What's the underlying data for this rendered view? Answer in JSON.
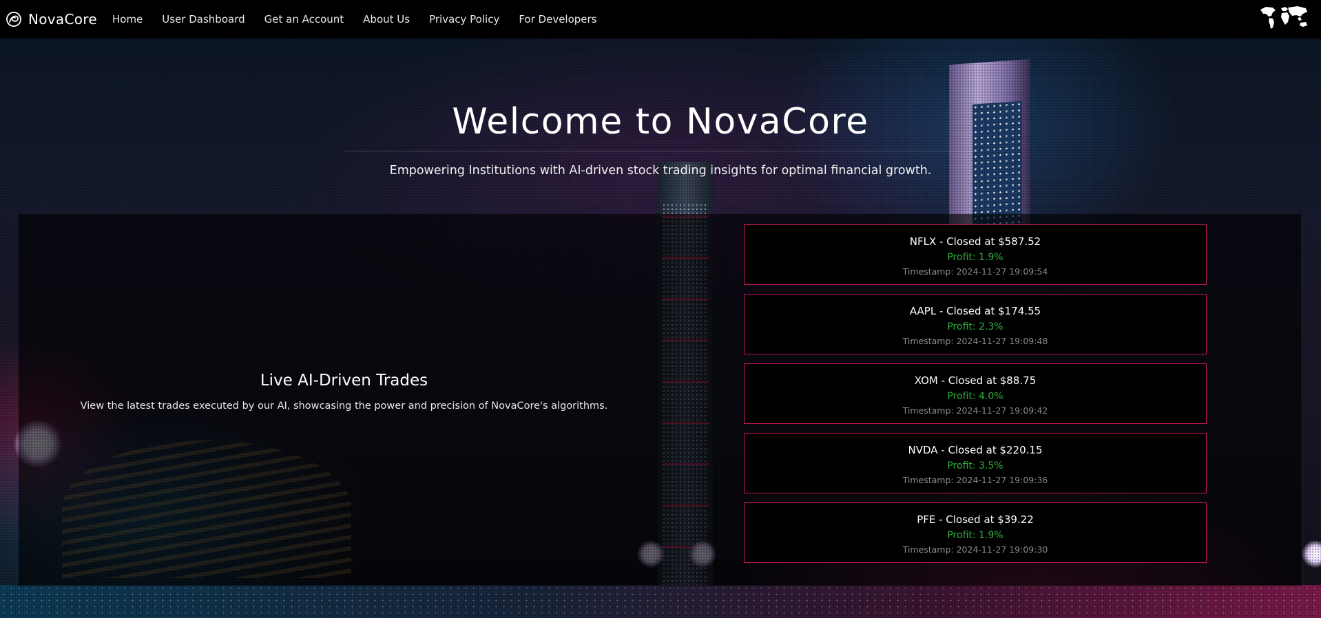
{
  "navbar": {
    "brand": "NovaCore",
    "links": [
      {
        "label": "Home"
      },
      {
        "label": "User Dashboard"
      },
      {
        "label": "Get an Account"
      },
      {
        "label": "About Us"
      },
      {
        "label": "Privacy Policy"
      },
      {
        "label": "For Developers"
      }
    ],
    "brand_icon": "swirl-logo-icon",
    "language_icon": "world-map-icon"
  },
  "hero": {
    "title": "Welcome to NovaCore",
    "subtitle": "Empowering Institutions with AI-driven stock trading insights for optimal financial growth."
  },
  "trades_section": {
    "title": "Live AI-Driven Trades",
    "description": "View the latest trades executed by our AI, showcasing the power and precision of NovaCore's algorithms.",
    "trades": [
      {
        "title": "NFLX - Closed at $587.52",
        "profit": "Profit: 1.9%",
        "timestamp": "Timestamp: 2024-11-27 19:09:54"
      },
      {
        "title": "AAPL - Closed at $174.55",
        "profit": "Profit: 2.3%",
        "timestamp": "Timestamp: 2024-11-27 19:09:48"
      },
      {
        "title": "XOM - Closed at $88.75",
        "profit": "Profit: 4.0%",
        "timestamp": "Timestamp: 2024-11-27 19:09:42"
      },
      {
        "title": "NVDA - Closed at $220.15",
        "profit": "Profit: 3.5%",
        "timestamp": "Timestamp: 2024-11-27 19:09:36"
      },
      {
        "title": "PFE - Closed at $39.22",
        "profit": "Profit: 1.9%",
        "timestamp": "Timestamp: 2024-11-27 19:09:30"
      }
    ]
  },
  "colors": {
    "navbar_bg": "#000000",
    "card_border": "#c2185b",
    "profit": "#2fae3c",
    "timestamp": "#8a8a8a"
  }
}
